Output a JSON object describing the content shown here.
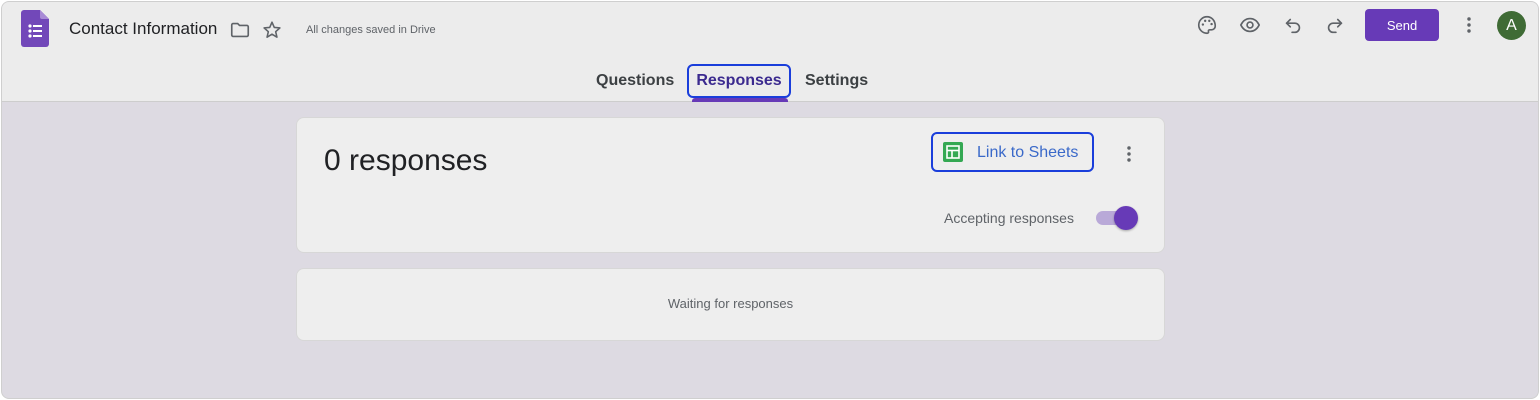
{
  "header": {
    "title": "Contact Information",
    "save_status": "All changes saved in Drive",
    "send_label": "Send",
    "avatar_initial": "A"
  },
  "tabs": [
    {
      "label": "Questions",
      "active": false
    },
    {
      "label": "Responses",
      "active": true
    },
    {
      "label": "Settings",
      "active": false
    }
  ],
  "summary": {
    "response_count": "0 responses",
    "link_sheets_label": "Link to Sheets",
    "accepting_label": "Accepting responses",
    "accepting_enabled": true
  },
  "waiting": {
    "text": "Waiting for responses"
  },
  "colors": {
    "accent": "#673ab7",
    "sheets_green": "#34a853",
    "highlight_outline": "#1a3edb",
    "avatar_bg": "#3f6b35"
  },
  "icons": [
    "forms-logo-icon",
    "folder-icon",
    "star-icon",
    "palette-icon",
    "eye-icon",
    "undo-icon",
    "redo-icon",
    "more-vert-icon",
    "sheets-icon"
  ]
}
